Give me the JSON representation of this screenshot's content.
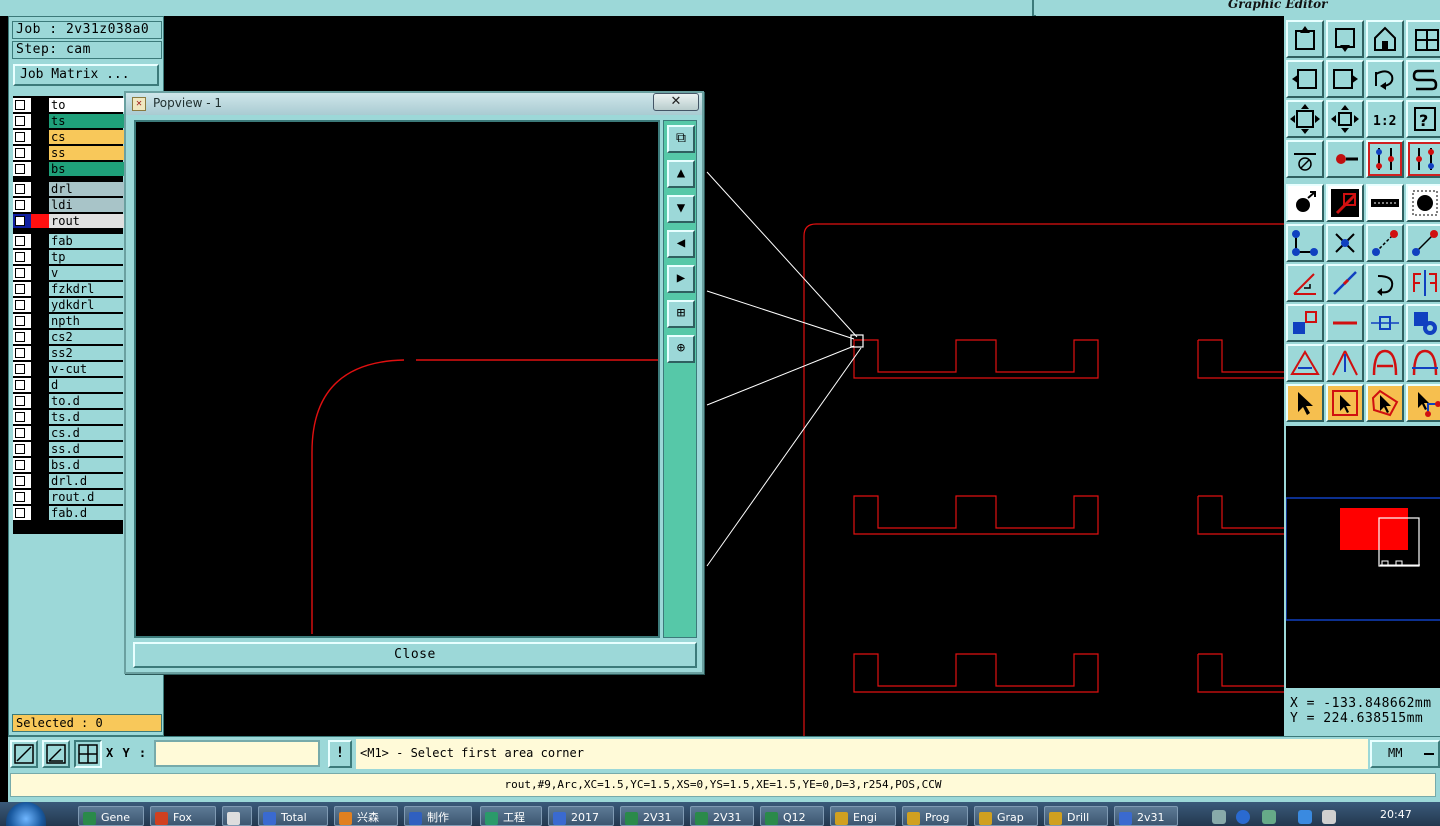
{
  "app": {
    "graphic_editor_title": "Graphic Editor"
  },
  "job": {
    "job_line": "Job : 2v31z038a0",
    "step_line": "Step: cam",
    "matrix_button": "Job Matrix ..."
  },
  "layers": [
    {
      "name": "to",
      "color": "#ffffff"
    },
    {
      "name": "ts",
      "color": "#1fa07a"
    },
    {
      "name": "cs",
      "color": "#f8c85a"
    },
    {
      "name": "ss",
      "color": "#f8c85a"
    },
    {
      "name": "bs",
      "color": "#1fa07a"
    },
    {
      "name": "drl",
      "color": "#a8c4c8"
    },
    {
      "name": "ldi",
      "color": "#a8c4c8"
    },
    {
      "name": "rout",
      "color": "#e0e0e0"
    },
    {
      "name": "fab",
      "color": "#9cd8d8"
    },
    {
      "name": "tp",
      "color": "#9cd8d8"
    },
    {
      "name": "v",
      "color": "#9cd8d8"
    },
    {
      "name": "fzkdrl",
      "color": "#9cd8d8"
    },
    {
      "name": "ydkdrl",
      "color": "#9cd8d8"
    },
    {
      "name": "npth",
      "color": "#9cd8d8"
    },
    {
      "name": "cs2",
      "color": "#9cd8d8"
    },
    {
      "name": "ss2",
      "color": "#9cd8d8"
    },
    {
      "name": "v-cut",
      "color": "#9cd8d8"
    },
    {
      "name": "d",
      "color": "#9cd8d8"
    },
    {
      "name": "to.d",
      "color": "#9cd8d8"
    },
    {
      "name": "ts.d",
      "color": "#9cd8d8"
    },
    {
      "name": "cs.d",
      "color": "#9cd8d8"
    },
    {
      "name": "ss.d",
      "color": "#9cd8d8"
    },
    {
      "name": "bs.d",
      "color": "#9cd8d8"
    },
    {
      "name": "drl.d",
      "color": "#9cd8d8"
    },
    {
      "name": "rout.d",
      "color": "#9cd8d8"
    },
    {
      "name": "fab.d",
      "color": "#9cd8d8"
    }
  ],
  "selected_text": "Selected : 0",
  "popview": {
    "title": "Popview - 1",
    "close_x": "✕",
    "close_button": "Close"
  },
  "coords": {
    "x": "X = -133.848662mm",
    "y": "Y = 224.638515mm"
  },
  "command": {
    "xy_label": "X Y :",
    "xy_value": "",
    "exclamation": "!",
    "prompt": "<M1> - Select first area corner",
    "units": "MM"
  },
  "status": "rout,#9,Arc,XC=1.5,YC=1.5,XS=0,YS=1.5,XE=1.5,YE=0,D=3,r254,POS,CCW",
  "taskbar": {
    "items": [
      "Gene",
      "Fox",
      "",
      "Total",
      "兴森",
      "制作",
      "工程",
      "2017",
      "2V31",
      "2V31",
      "Q12",
      "Engi",
      "Prog",
      "Grap",
      "Drill",
      "2v31"
    ],
    "clock": "20:47"
  },
  "colors": {
    "panel": "#9cd8d8",
    "rout_line": "#e01010",
    "highlight": "#f8c85a"
  }
}
